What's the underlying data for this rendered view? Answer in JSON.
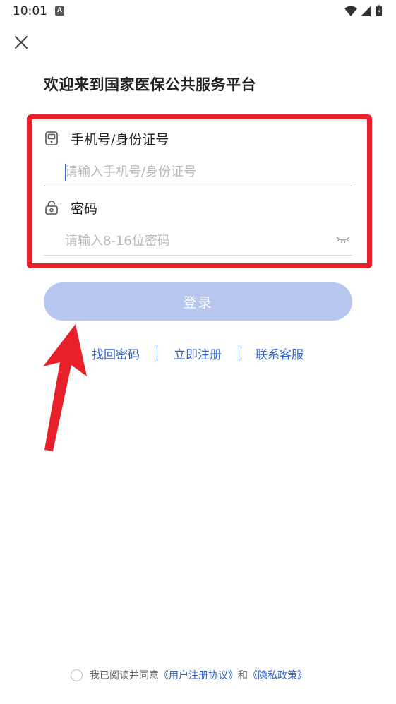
{
  "status_bar": {
    "time": "10:01",
    "notification_icon_letter": "A"
  },
  "header": {
    "title": "欢迎来到国家医保公共服务平台"
  },
  "form": {
    "account": {
      "label": "手机号/身份证号",
      "placeholder": "请输入手机号/身份证号",
      "value": ""
    },
    "password": {
      "label": "密码",
      "placeholder": "请输入8-16位密码",
      "value": ""
    }
  },
  "actions": {
    "login_label": "登录",
    "links": [
      "找回密码",
      "立即注册",
      "联系客服"
    ]
  },
  "agreement": {
    "prefix": "我已阅读并同意",
    "user_agreement": "《用户注册协议》",
    "conjunction": "和",
    "privacy_policy": "《隐私政策》",
    "checked": false
  },
  "colors": {
    "accent": "#2d5fc4",
    "login_button": "#b7c7f0",
    "annotation_red": "#e8202a"
  },
  "icons": {
    "close": "close-icon",
    "account": "phone-icon",
    "password": "lock-icon",
    "visibility": "eye-closed-icon"
  }
}
